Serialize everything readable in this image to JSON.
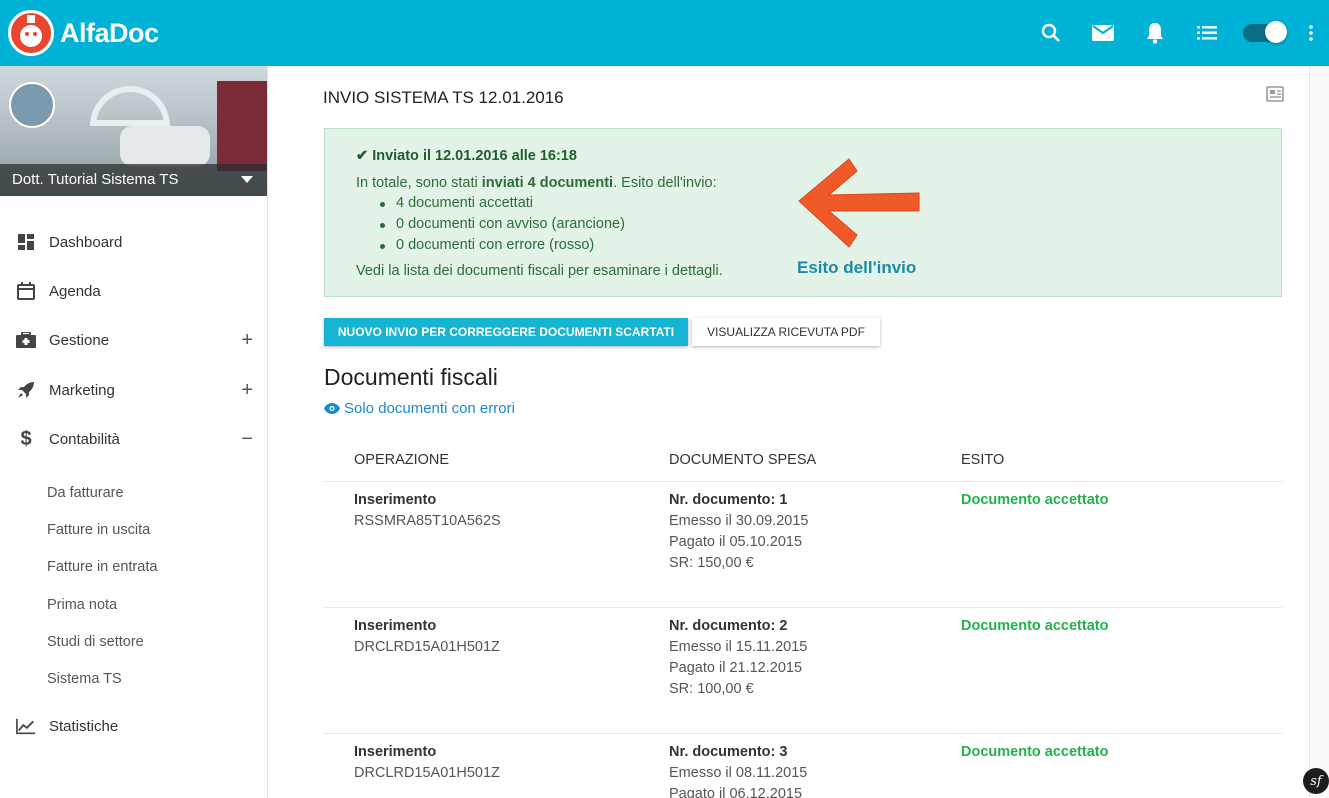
{
  "app": {
    "brand": "AlfaDoc"
  },
  "topbar": {
    "icons": [
      "search-icon",
      "mail-icon",
      "bell-icon",
      "list-icon",
      "toggle",
      "more-vert-icon"
    ]
  },
  "sidebar": {
    "user_name": "Dott. Tutorial Sistema TS",
    "items": [
      {
        "label": "Dashboard",
        "icon": "dashboard-icon",
        "expander": ""
      },
      {
        "label": "Agenda",
        "icon": "calendar-icon",
        "expander": ""
      },
      {
        "label": "Gestione",
        "icon": "medical-bag-icon",
        "expander": "+"
      },
      {
        "label": "Marketing",
        "icon": "rocket-icon",
        "expander": "+"
      },
      {
        "label": "Contabilità",
        "icon": "dollar-icon",
        "expander": "−"
      },
      {
        "label": "Statistiche",
        "icon": "trending-up-icon",
        "expander": ""
      }
    ],
    "subitems": [
      "Da fatturare",
      "Fatture in uscita",
      "Fatture in entrata",
      "Prima nota",
      "Studi di settore",
      "Sistema TS"
    ]
  },
  "main": {
    "title": "INVIO SISTEMA TS 12.01.2016",
    "alert": {
      "heading": "Inviato il 12.01.2016 alle 16:18",
      "summary_prefix": "In totale, sono stati ",
      "summary_bold": "inviati 4 documenti",
      "summary_suffix": ". Esito dell'invio:",
      "items": [
        "4 documenti accettati",
        "0 documenti con avviso (arancione)",
        "0 documenti con errore (rosso)"
      ],
      "footer": "Vedi la lista dei documenti fiscali per esaminare i dettagli.",
      "annotation": "Esito dell'invio",
      "annotation_color": "#1a8aa8",
      "arrow_color": "#f05a28"
    },
    "buttons": {
      "primary": "NUOVO INVIO PER CORREGGERE DOCUMENTI SCARTATI",
      "secondary": "VISUALIZZA RICEVUTA PDF"
    },
    "section_title": "Documenti fiscali",
    "filter_link": "Solo documenti con errori",
    "table": {
      "headers": [
        "OPERAZIONE",
        "DOCUMENTO SPESA",
        "ESITO"
      ],
      "rows": [
        {
          "op": "Inserimento",
          "code": "RSSMRA85T10A562S",
          "doc": "Nr. documento: 1",
          "emesso": "Emesso il 30.09.2015",
          "pagato": "Pagato il 05.10.2015",
          "sr": "SR: 150,00 €",
          "esito": "Documento accettato"
        },
        {
          "op": "Inserimento",
          "code": "DRCLRD15A01H501Z",
          "doc": "Nr. documento: 2",
          "emesso": "Emesso il 15.11.2015",
          "pagato": "Pagato il 21.12.2015",
          "sr": "SR: 100,00 €",
          "esito": "Documento accettato"
        },
        {
          "op": "Inserimento",
          "code": "DRCLRD15A01H501Z",
          "doc": "Nr. documento: 3",
          "emesso": "Emesso il 08.11.2015",
          "pagato": "Pagato il 06.12.2015",
          "sr": "",
          "esito": "Documento accettato"
        }
      ]
    }
  },
  "colors": {
    "topbar": "#00b2d6",
    "accent": "#16b4d3",
    "success": "#22b14c",
    "alert_bg": "#e4f3e8"
  }
}
